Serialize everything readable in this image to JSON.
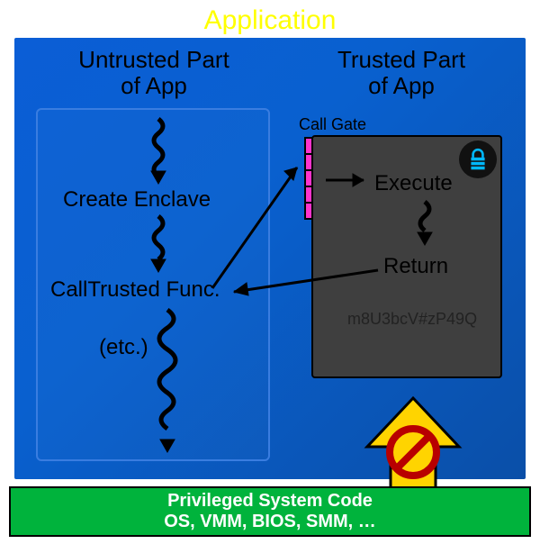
{
  "title": "Application",
  "untrusted": {
    "heading": "Untrusted Part\nof App",
    "step_create": "Create Enclave",
    "step_call": "CallTrusted Func.",
    "step_etc": "(etc.)"
  },
  "trusted": {
    "heading": "Trusted Part\nof App",
    "callgate_label": "Call Gate",
    "execute": "Execute",
    "return": "Return",
    "secret": "m8U3bcV#zP49Q"
  },
  "privileged": {
    "line1": "Privileged System Code",
    "line2": "OS, VMM, BIOS, SMM, …"
  },
  "colors": {
    "title": "#ffff00",
    "app_bg_from": "#0b5ed6",
    "app_bg_to": "#0a4fa8",
    "callgate": "#ff33cc",
    "trusted_panel": "#3f3f3f",
    "priv_bar": "#00b33c",
    "block_arrow": "#ffd400",
    "prohibit": "#b80000",
    "lock": "#00b8ff"
  }
}
